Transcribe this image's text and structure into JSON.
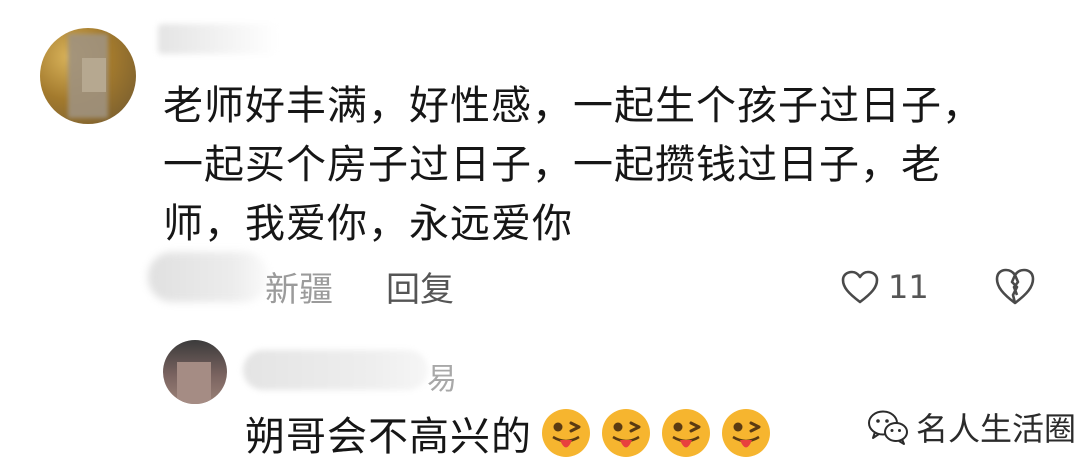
{
  "comment": {
    "text": "老师好丰满，好性感，一起生个孩子过日子，一起买个房子过日子，一起攒钱过日子，老师，我爱你，永远爱你",
    "location": "新疆",
    "reply_label": "回复",
    "likes": "11"
  },
  "reply": {
    "username_visible": "易",
    "text": "朔哥会不高兴的",
    "emojis": [
      "tongue-wink-emoji",
      "tongue-wink-emoji",
      "tongue-wink-emoji",
      "tongue-wink-emoji"
    ]
  },
  "watermark": {
    "text": "名人生活圈",
    "icon": "wechat-icon"
  },
  "colors": {
    "text": "#161616",
    "muted": "#9b9b9b",
    "emoji_face": "#f6b52f",
    "emoji_tongue": "#e8413e"
  }
}
